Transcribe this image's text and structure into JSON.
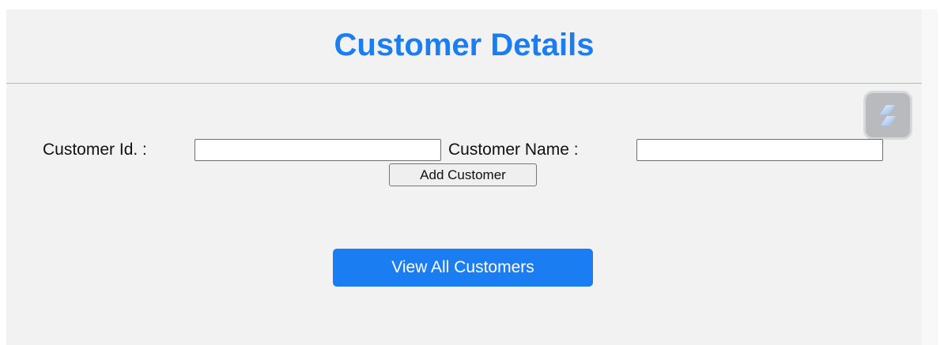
{
  "header": {
    "title": "Customer Details"
  },
  "form": {
    "customer_id_label": "Customer Id. :",
    "customer_id_value": "",
    "customer_name_label": "Customer Name :",
    "customer_name_value": "",
    "add_button_label": "Add Customer"
  },
  "actions": {
    "view_all_label": "View All Customers"
  },
  "extension": {
    "icon": "extension-logo-icon"
  },
  "colors": {
    "accent": "#1a7ef2",
    "background": "#f2f2f2"
  }
}
